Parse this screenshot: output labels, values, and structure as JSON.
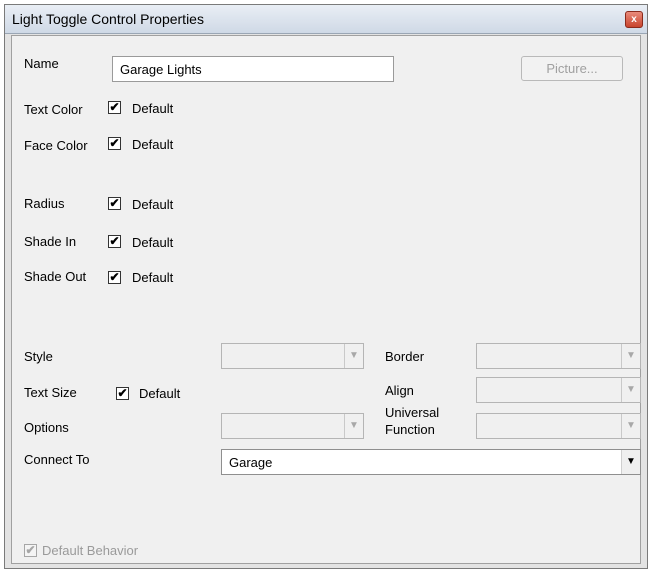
{
  "window": {
    "title": "Light Toggle Control Properties",
    "close_label": "x"
  },
  "form": {
    "name_label": "Name",
    "name_value": "Garage Lights",
    "picture_button": "Picture...",
    "text_color_label": "Text Color",
    "face_color_label": "Face Color",
    "radius_label": "Radius",
    "shade_in_label": "Shade In",
    "shade_out_label": "Shade Out",
    "default_label": "Default",
    "checked_mark": "✔",
    "style_label": "Style",
    "text_size_label": "Text Size",
    "options_label": "Options",
    "connect_to_label": "Connect To",
    "connect_to_value": "Garage",
    "border_label": "Border",
    "align_label": "Align",
    "universal_label": "Universal",
    "function_label": "Function",
    "default_behavior_label": "Default Behavior",
    "dropdown_arrow": "▼"
  }
}
